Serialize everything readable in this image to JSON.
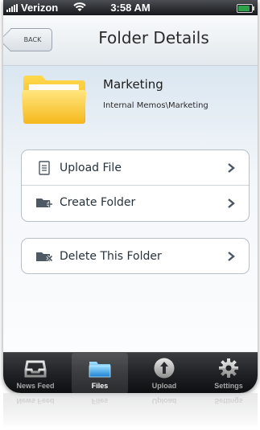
{
  "status_bar": {
    "carrier": "Verizon",
    "time": "3:58 AM",
    "battery_icon": "battery-charging-icon",
    "wifi_icon": "wifi-icon",
    "signal_icon": "signal-bars-icon"
  },
  "nav": {
    "back_label": "BACK",
    "title": "Folder Details"
  },
  "folder": {
    "name": "Marketing",
    "path": "Internal Memos\\Marketing",
    "icon": "folder-icon"
  },
  "actions": [
    {
      "label": "Upload File",
      "icon": "document-icon"
    },
    {
      "label": "Create Folder",
      "icon": "folder-add-icon"
    }
  ],
  "danger_actions": [
    {
      "label": "Delete This Folder",
      "icon": "folder-delete-icon"
    }
  ],
  "tabs": [
    {
      "label": "News Feed",
      "icon": "inbox-icon",
      "active": false
    },
    {
      "label": "Files",
      "icon": "folder-icon",
      "active": true
    },
    {
      "label": "Upload",
      "icon": "upload-arrow-icon",
      "active": false
    },
    {
      "label": "Settings",
      "icon": "gear-icon",
      "active": false
    }
  ],
  "colors": {
    "background": "#eaf1f7",
    "folder_yellow": "#ffc928",
    "tab_bar": "#202225",
    "active_tab_icon": "#3ba6ea"
  }
}
